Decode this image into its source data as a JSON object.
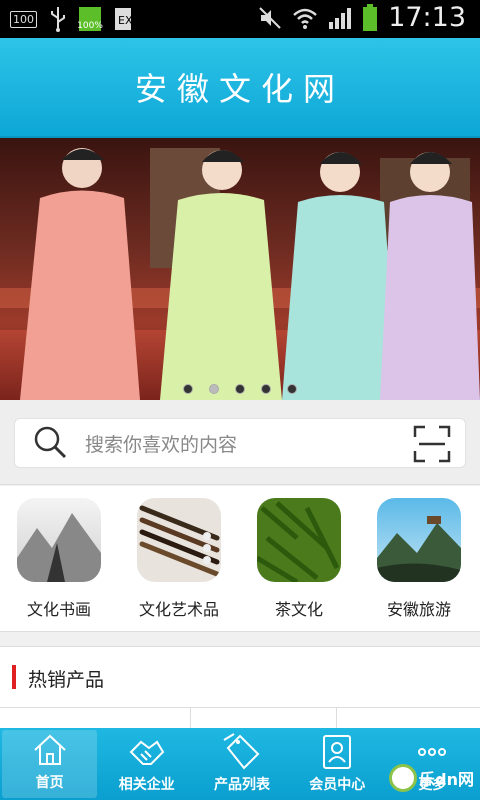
{
  "status_bar": {
    "notif_box": "100",
    "battery_small_pct": "100%",
    "time": "17:13"
  },
  "header": {
    "title": "安徽文化网"
  },
  "banner": {
    "slides": 5,
    "active_slide": 2
  },
  "search": {
    "placeholder": "搜索你喜欢的内容"
  },
  "categories": [
    {
      "label": "文化书画",
      "icon": "landscape-painting-thumb"
    },
    {
      "label": "文化艺术品",
      "icon": "brushes-thumb"
    },
    {
      "label": "茶文化",
      "icon": "tea-leaves-thumb"
    },
    {
      "label": "安徽旅游",
      "icon": "mountain-pavilion-thumb"
    }
  ],
  "hot": {
    "title": "热销产品",
    "accent": "#e02020"
  },
  "tabs": [
    {
      "label": "首页",
      "icon": "home-icon",
      "active": true
    },
    {
      "label": "相关企业",
      "icon": "handshake-icon"
    },
    {
      "label": "产品列表",
      "icon": "sale-tag-icon"
    },
    {
      "label": "会员中心",
      "icon": "member-card-icon"
    },
    {
      "label": "更多",
      "icon": "more-dots-icon"
    }
  ],
  "watermark": {
    "text": "乐dn网"
  }
}
